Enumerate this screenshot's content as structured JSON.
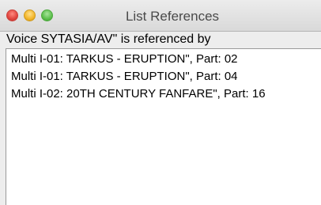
{
  "window": {
    "title": "List References"
  },
  "header": {
    "text": "Voice SYTASIA/AV\" is referenced by"
  },
  "references": [
    "Multi I-01: TARKUS - ERUPTION\", Part: 02",
    "Multi I-01: TARKUS - ERUPTION\", Part: 04",
    "Multi I-02: 20TH CENTURY FANFARE\", Part: 16"
  ],
  "colors": {
    "close": "#e0443e",
    "minimize": "#f2b52a",
    "zoom": "#5cbf4c"
  }
}
